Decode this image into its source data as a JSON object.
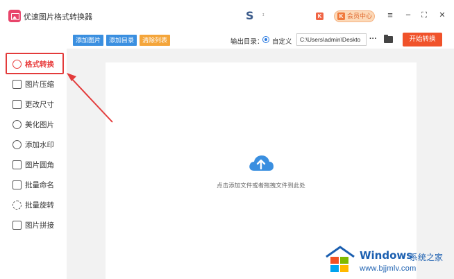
{
  "app": {
    "title": "优速图片格式转换器",
    "logo_icon": "image-logo-icon",
    "s_text": "S",
    "s_sub": "ɪ",
    "k_badge": "K",
    "vip_label": "会员中心",
    "vip_icon": "K",
    "menu_glyph": "≡",
    "min_glyph": "−",
    "max_glyph": "⛶",
    "close_glyph": "✕"
  },
  "sidebar": {
    "items": [
      {
        "label": "格式转换",
        "icon": "format-convert-icon",
        "active": true
      },
      {
        "label": "图片压缩",
        "icon": "compress-icon",
        "active": false
      },
      {
        "label": "更改尺寸",
        "icon": "resize-icon",
        "active": false
      },
      {
        "label": "美化图片",
        "icon": "beautify-icon",
        "active": false
      },
      {
        "label": "添加水印",
        "icon": "watermark-icon",
        "active": false
      },
      {
        "label": "图片圆角",
        "icon": "rounded-corner-icon",
        "active": false
      },
      {
        "label": "批量命名",
        "icon": "rename-icon",
        "active": false
      },
      {
        "label": "批量旋转",
        "icon": "rotate-icon",
        "active": false
      },
      {
        "label": "图片拼接",
        "icon": "stitch-icon",
        "active": false
      }
    ]
  },
  "toolbar": {
    "add_image": "添加图片",
    "add_folder": "添加目录",
    "clear_list": "清除列表",
    "output_label": "输出目录：",
    "custom_label": "自定义",
    "path_value": "C:\\Users\\admin\\Deskto",
    "more_glyph": "···",
    "start_label": "开始转换"
  },
  "dropzone": {
    "hint": "点击添加文件或者拖拽文件到此处",
    "icon": "cloud-upload-icon"
  },
  "watermark": {
    "title": "Windows",
    "subtitle": "系统之家",
    "url": "www.bjjmlv.com"
  },
  "colors": {
    "accent_blue": "#3a8fe0",
    "accent_orange": "#f4a53a",
    "start_red": "#f0522a",
    "highlight_red": "#e33b3b"
  }
}
